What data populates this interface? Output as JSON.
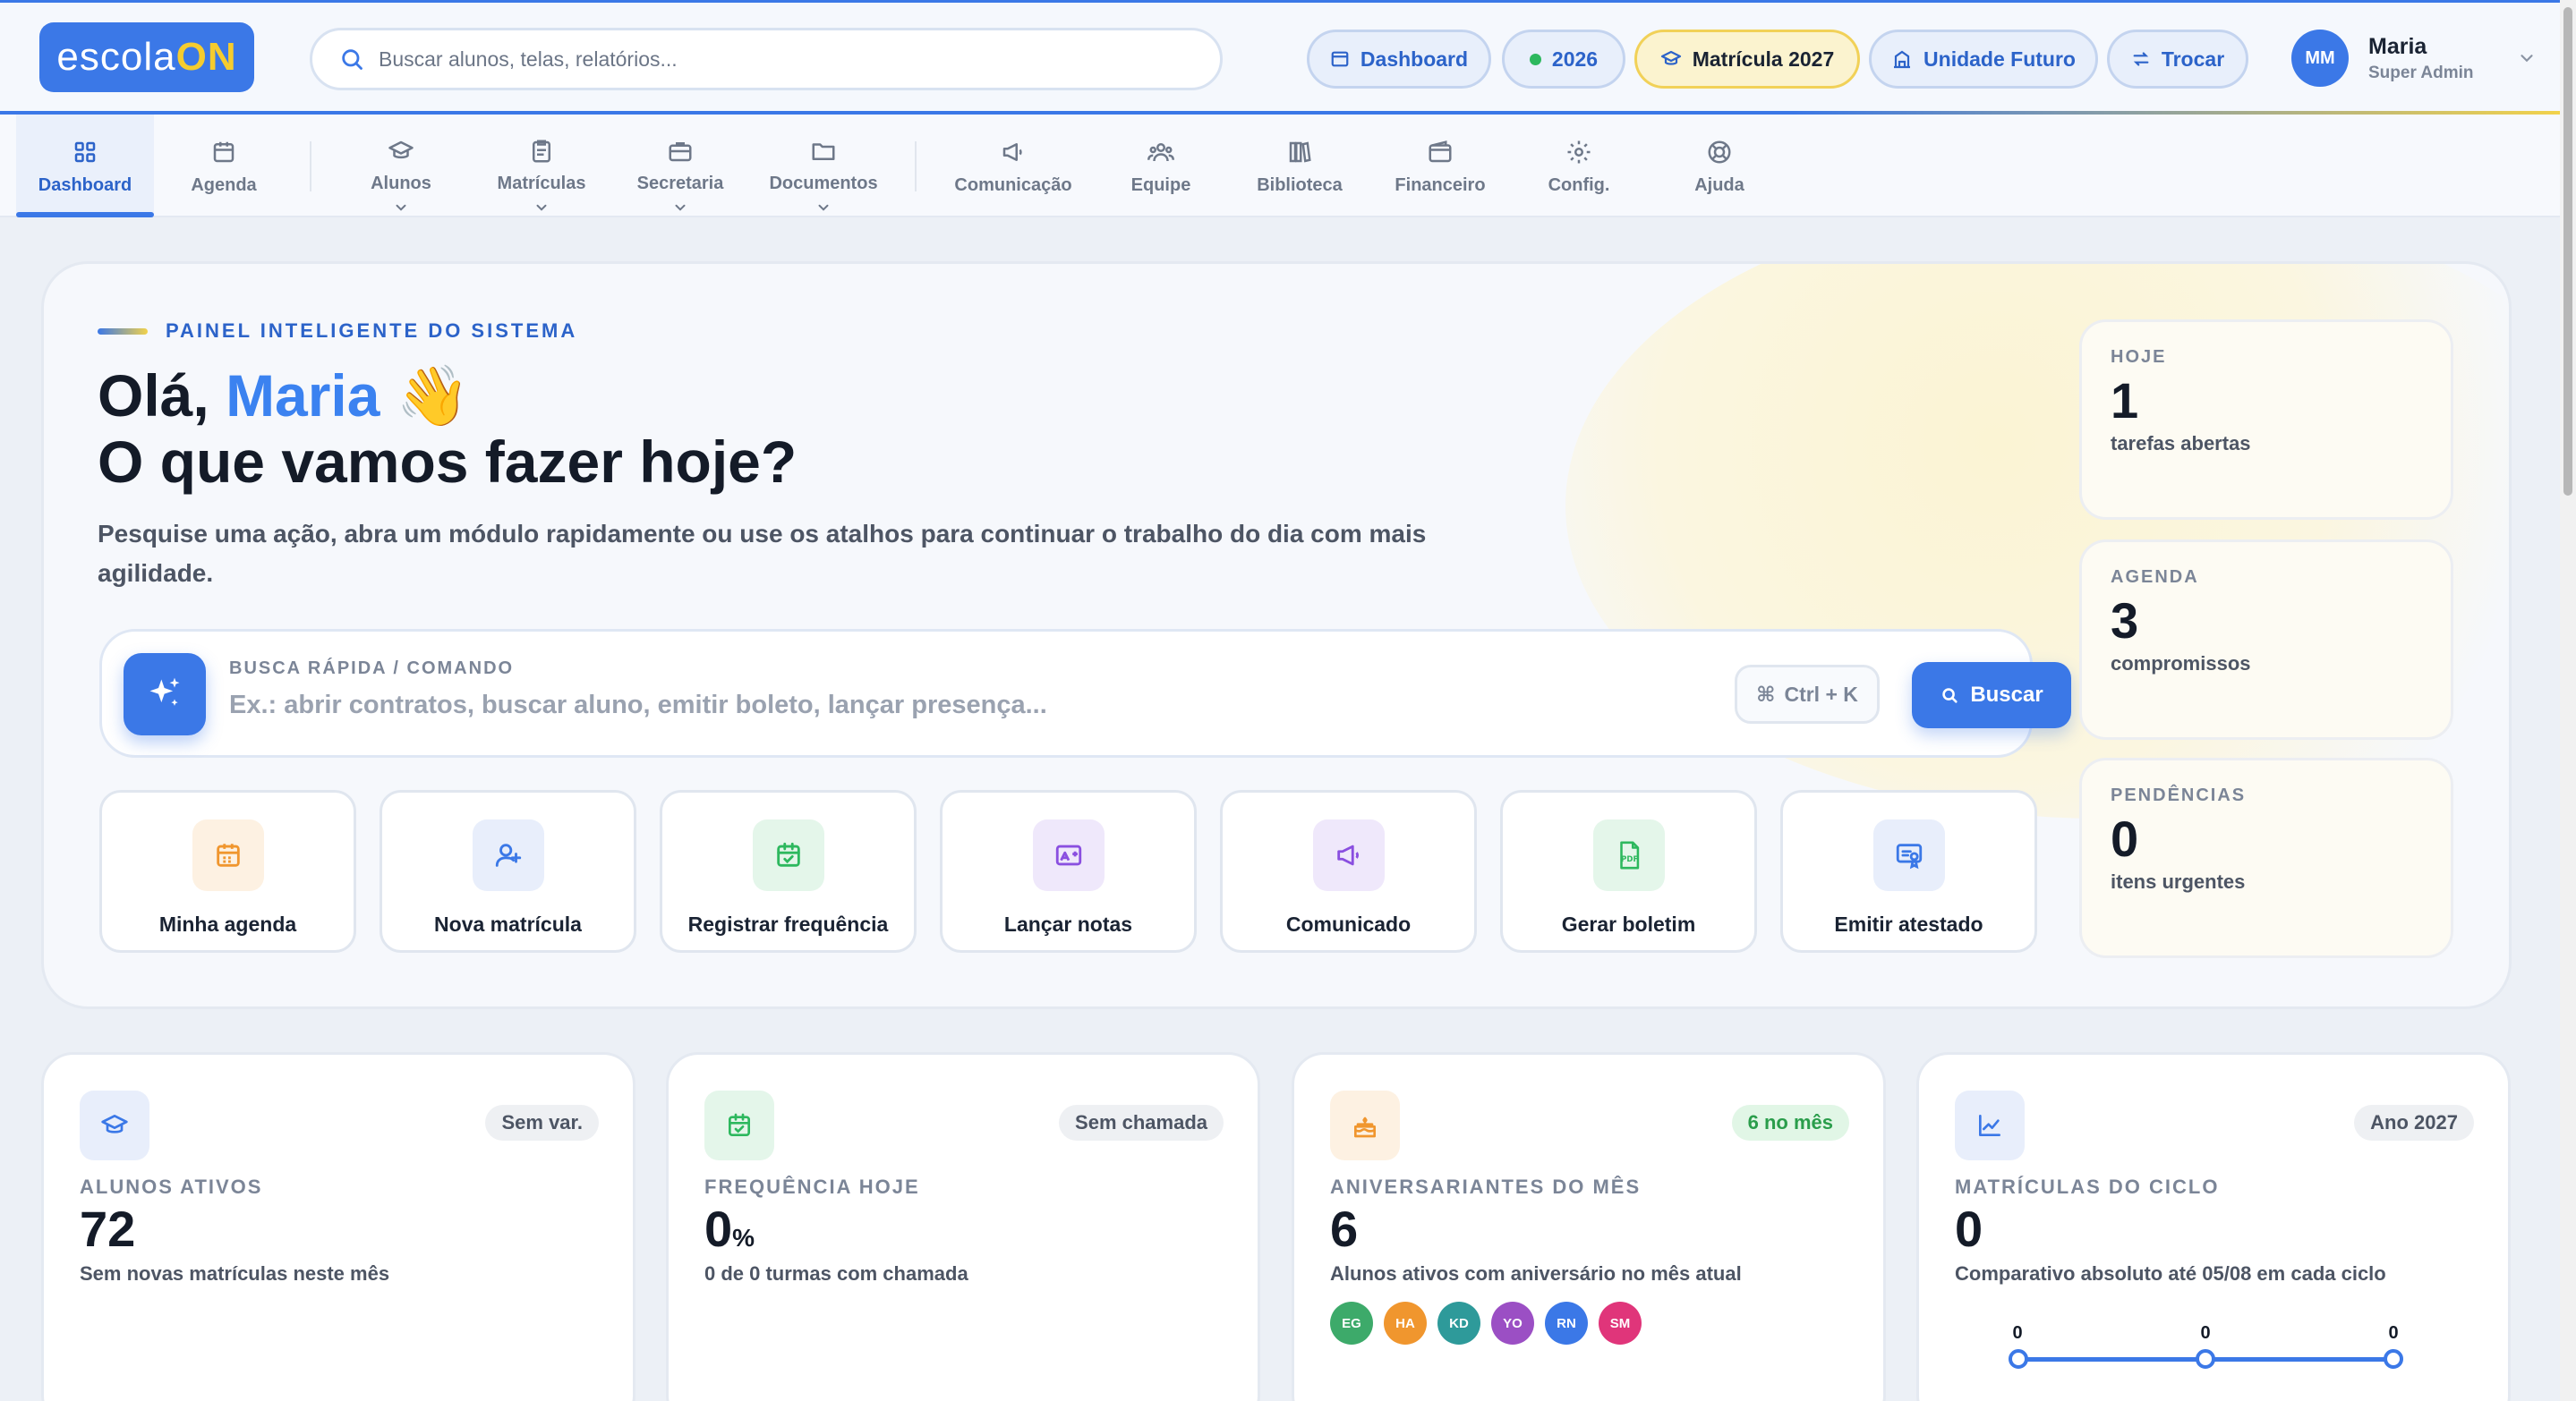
{
  "brand": {
    "name": "escola",
    "suffix": "ON"
  },
  "search": {
    "placeholder": "Buscar alunos, telas, relatórios..."
  },
  "chips": [
    {
      "label": "Dashboard",
      "icon": "window-icon"
    },
    {
      "label": "2026",
      "icon": "status-dot",
      "color": "#2db85e"
    },
    {
      "label": "Matrícula 2027",
      "icon": "graduation-cap-icon"
    },
    {
      "label": "Unidade Futuro",
      "icon": "building-icon"
    },
    {
      "label": "Trocar",
      "icon": "swap-icon"
    }
  ],
  "user": {
    "initials": "MM",
    "name": "Maria",
    "role": "Super Admin"
  },
  "nav": [
    {
      "label": "Dashboard",
      "icon": "grid-icon",
      "active": true
    },
    {
      "label": "Agenda",
      "icon": "calendar-icon"
    },
    {
      "label": "Alunos",
      "icon": "graduation-cap-icon",
      "dropdown": true
    },
    {
      "label": "Matrículas",
      "icon": "clipboard-icon",
      "dropdown": true
    },
    {
      "label": "Secretaria",
      "icon": "briefcase-icon",
      "dropdown": true
    },
    {
      "label": "Documentos",
      "icon": "folder-icon",
      "dropdown": true
    },
    {
      "label": "Comunicação",
      "icon": "megaphone-icon"
    },
    {
      "label": "Equipe",
      "icon": "team-icon"
    },
    {
      "label": "Biblioteca",
      "icon": "books-icon"
    },
    {
      "label": "Financeiro",
      "icon": "wallet-icon"
    },
    {
      "label": "Config.",
      "icon": "gear-icon"
    },
    {
      "label": "Ajuda",
      "icon": "lifebuoy-icon"
    }
  ],
  "hero": {
    "kicker": "PAINEL INTELIGENTE DO SISTEMA",
    "greeting": "Olá,",
    "name": "Maria",
    "emoji": "👋",
    "question": "O que vamos fazer hoje?",
    "lead": "Pesquise uma ação, abra um módulo rapidamente ou use os atalhos para continuar o trabalho do dia com mais agilidade."
  },
  "command": {
    "label": "BUSCA RÁPIDA / COMANDO",
    "placeholder": "Ex.: abrir contratos, buscar aluno, emitir boleto, lançar presença...",
    "shortcut": "Ctrl + K",
    "button": "Buscar"
  },
  "actions": [
    {
      "label": "Minha agenda",
      "icon": "calendar-icon",
      "bg": "#fdf1e2",
      "color": "#f0962e"
    },
    {
      "label": "Nova matrícula",
      "icon": "user-plus-icon",
      "bg": "#e8eefb",
      "color": "#3b78e7"
    },
    {
      "label": "Registrar frequência",
      "icon": "calendar-check-icon",
      "bg": "#e4f6ea",
      "color": "#2db85e"
    },
    {
      "label": "Lançar notas",
      "icon": "grade-image-icon",
      "bg": "#efe8fb",
      "color": "#8a4fe0"
    },
    {
      "label": "Comunicado",
      "icon": "megaphone-icon",
      "bg": "#efe8fb",
      "color": "#8a4fe0"
    },
    {
      "label": "Gerar boletim",
      "icon": "pdf-icon",
      "bg": "#e4f6ea",
      "color": "#2db85e"
    },
    {
      "label": "Emitir atestado",
      "icon": "certificate-icon",
      "bg": "#e8eefb",
      "color": "#3b78e7"
    }
  ],
  "side": [
    {
      "title": "HOJE",
      "value": "1",
      "sub": "tarefas abertas"
    },
    {
      "title": "AGENDA",
      "value": "3",
      "sub": "compromissos"
    },
    {
      "title": "PENDÊNCIAS",
      "value": "0",
      "sub": "itens urgentes"
    }
  ],
  "stats": [
    {
      "title": "ALUNOS ATIVOS",
      "value": "72",
      "unit": "",
      "sub": "Sem novas matrículas neste mês",
      "badge": "Sem var.",
      "icon": "graduation-cap-icon",
      "bg": "#e8eefb",
      "color": "#3b78e7"
    },
    {
      "title": "FREQUÊNCIA HOJE",
      "value": "0",
      "unit": "%",
      "sub": "0 de 0 turmas com chamada",
      "badge": "Sem chamada",
      "icon": "calendar-check-icon",
      "bg": "#e4f6ea",
      "color": "#2db85e"
    },
    {
      "title": "ANIVERSARIANTES DO MÊS",
      "value": "6",
      "unit": "",
      "sub": "Alunos ativos com aniversário no mês atual",
      "badge": "6 no mês",
      "icon": "cake-icon",
      "bg": "#fdf1e2",
      "color": "#f0962e"
    },
    {
      "title": "MATRÍCULAS DO CICLO",
      "value": "0",
      "unit": "",
      "sub": "Comparativo absoluto até 05/08 em cada ciclo",
      "badge": "Ano 2027",
      "icon": "trend-chart-icon",
      "bg": "#e8eefb",
      "color": "#3b78e7"
    }
  ],
  "birthdays": [
    {
      "initials": "EG",
      "color": "#3daa6a"
    },
    {
      "initials": "HA",
      "color": "#f0962e"
    },
    {
      "initials": "KD",
      "color": "#2e9a9a"
    },
    {
      "initials": "YO",
      "color": "#9b4fc4"
    },
    {
      "initials": "RN",
      "color": "#3b78e7"
    },
    {
      "initials": "SM",
      "color": "#e0357a"
    }
  ],
  "cycle_points": [
    "0",
    "0",
    "0"
  ]
}
